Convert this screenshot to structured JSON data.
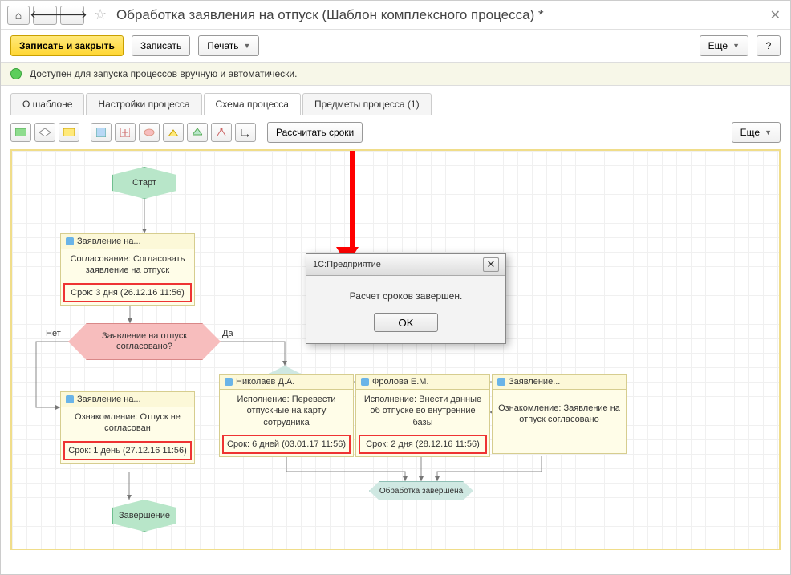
{
  "titlebar": {
    "title": "Обработка заявления на отпуск (Шаблон комплексного процесса) *"
  },
  "cmdbar": {
    "save_close": "Записать и закрыть",
    "save": "Записать",
    "print": "Печать",
    "more": "Еще",
    "help": "?"
  },
  "status": {
    "text": "Доступен для запуска процессов вручную и автоматически."
  },
  "tabs": {
    "t1": "О шаблоне",
    "t2": "Настройки процесса",
    "t3": "Схема процесса",
    "t4": "Предметы процесса (1)"
  },
  "toolbar": {
    "calc": "Рассчитать сроки",
    "more": "Еще"
  },
  "flow": {
    "start": "Старт",
    "end": "Завершение",
    "no": "Нет",
    "yes": "Да",
    "decision": "Заявление на отпуск согласовано?",
    "merge": "Обработка завершена",
    "n1": {
      "head": "Заявление  на...",
      "body": "Согласование: Согласовать заявление на отпуск",
      "deadline": "Срок: 3 дня (26.12.16 11:56)"
    },
    "n2": {
      "head": "Заявление  на...",
      "body": "Ознакомление: Отпуск не согласован",
      "deadline": "Срок: 1 день (27.12.16 11:56)"
    },
    "n3": {
      "head": "Николаев Д.А.",
      "body": "Исполнение: Перевести отпускные на карту сотрудника",
      "deadline": "Срок: 6 дней (03.01.17 11:56)"
    },
    "n4": {
      "head": "Фролова Е.М.",
      "body": "Исполнение: Внести данные об отпуске во внутренние базы",
      "deadline": "Срок: 2 дня (28.12.16 11:56)"
    },
    "n5": {
      "head": "Заявление...",
      "body": "Ознакомление: Заявление на отпуск согласовано"
    }
  },
  "dialog": {
    "title": "1С:Предприятие",
    "msg": "Расчет сроков завершен.",
    "ok": "OK"
  }
}
